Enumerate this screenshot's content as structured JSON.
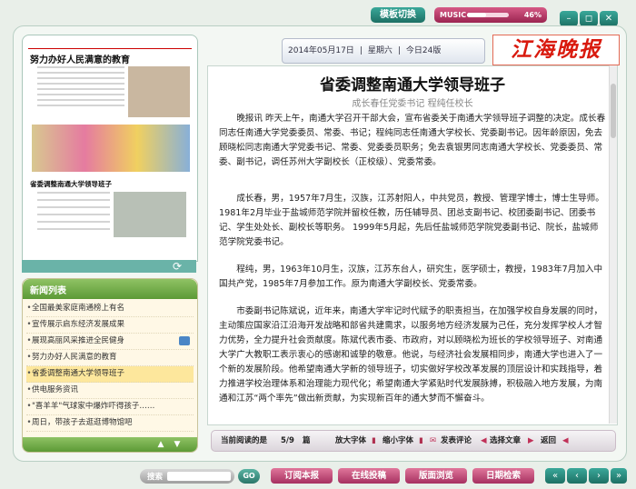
{
  "topbar": {
    "template_button": "模板切换",
    "music_label": "MUSIC",
    "music_volume_fraction": 0.46,
    "music_volume_text": "46%",
    "window_buttons": [
      "minimize-icon",
      "restore-icon",
      "close-icon"
    ]
  },
  "header": {
    "date": "2014年05月17日",
    "weekday": "星期六",
    "pages": "今日24版",
    "logo": "江海晚报"
  },
  "thumbnail": {
    "headline": "努力办好人民满意的教育",
    "sub_headline": "省委调整南通大学领导班子"
  },
  "news_list": {
    "title": "新闻列表",
    "items": [
      {
        "label": "全国最美家庭南通榜上有名"
      },
      {
        "label": "宣传展示启东经济发展成果"
      },
      {
        "label": "展现高丽风采推进全民健身"
      },
      {
        "label": "努力办好人民满意的教育"
      },
      {
        "label": "省委调整南通大学领导班子"
      },
      {
        "label": "供电服务资讯"
      },
      {
        "label": "\"喜羊羊\"气球家中爆炸吓得孩子……"
      },
      {
        "label": "周日，带孩子去逛逛博物馆吧"
      }
    ]
  },
  "article": {
    "title": "省委调整南通大学领导班子",
    "subtitle": "成长春任党委书记 程纯任校长",
    "paragraphs": [
      "晚报讯 昨天上午，南通大学召开干部大会，宣布省委关于南通大学领导班子调整的决定。成长春同志任南通大学党委委员、常委、书记；程纯同志任南通大学校长、党委副书记。因年龄原因，免去顾晓松同志南通大学党委书记、常委、党委委员职务；免去袁银男同志南通大学校长、党委委员、常委、副书记，调任苏州大学副校长（正校级）、党委常委。",
      "成长春，男，1957年7月生，汉族，江苏射阳人，中共党员，教授、管理学博士，博士生导师。 1981年2月毕业于盐城师范学院并留校任教，历任辅导员、团总支副书记、校团委副书记、团委书记、学生处处长、副校长等职务。 1999年5月起，先后任盐城师范学院党委副书记、院长，盐城师范学院党委书记。",
      "程纯，男，1963年10月生，汉族，江苏东台人，研究生，医学硕士，教授，1983年7月加入中国共产党，1985年7月参加工作。原为南通大学副校长、党委常委。",
      "市委副书记陈斌说，近年来，南通大学牢记时代赋予的职责担当，在加强学校自身发展的同时，主动策应国家沿江沿海开发战略和部省共建需求，以服务地方经济发展为己任，充分发挥学校人才智力优势，全力提升社会贡献度。陈斌代表市委、市政府，对以顾晓松为班长的学校领导班子、对南通大学广大教职工表示衷心的感谢和诚挚的敬意。他说，与经济社会发展相同步，南通大学也进入了一个新的发展阶段。他希望南通大学新的领导班子，切实做好学校改革发展的顶层设计和实践指导，着力推进学校治理体系和治理能力现代化；希望南通大学紧贴时代发展脉搏，积极融入地方发展，为南通和江苏“两个率先”做出新贡献，为实现新百年的通大梦而不懈奋斗。"
    ]
  },
  "article_bar": {
    "reading_label": "当前阅读的是",
    "reading_value": "5/9",
    "reading_unit": "篇",
    "enlarge": "放大字体",
    "shrink": "缩小字体",
    "comment": "发表评论",
    "select": "选择文章",
    "back": "返回"
  },
  "bottom": {
    "search_label": "搜索",
    "search_value": "",
    "go_label": "GO",
    "buttons": [
      "订阅本报",
      "在线投稿",
      "版面浏览",
      "日期检索"
    ]
  }
}
